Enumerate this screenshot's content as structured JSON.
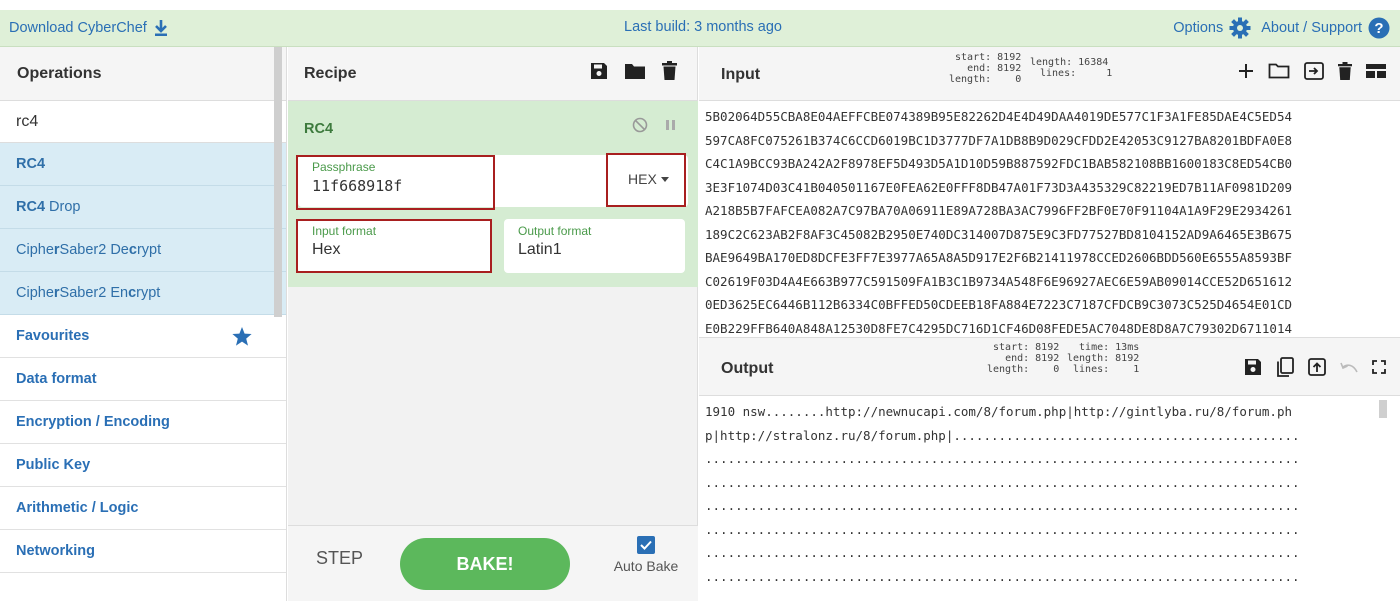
{
  "banner": {
    "download_label": "Download CyberChef",
    "build_label": "Last build: 3 months ago",
    "options_label": "Options",
    "about_label": "About / Support"
  },
  "operations": {
    "header": "Operations",
    "search_value": "rc4",
    "results": [
      {
        "strong": "RC4",
        "rest": ""
      },
      {
        "strong": "RC4",
        "rest": " Drop"
      },
      {
        "pre": "Ciphe",
        "strong": "r",
        "mid": "Saber2 De",
        "strong2": "c",
        "post": "rypt"
      },
      {
        "pre": "Ciphe",
        "strong": "r",
        "mid": "Saber2 En",
        "strong2": "c",
        "post": "rypt"
      }
    ],
    "categories": [
      "Favourites",
      "Data format",
      "Encryption / Encoding",
      "Public Key",
      "Arithmetic / Logic",
      "Networking"
    ]
  },
  "recipe": {
    "header": "Recipe",
    "operation_title": "RC4",
    "passphrase_label": "Passphrase",
    "passphrase_value": "11f668918f",
    "passphrase_format": "HEX",
    "input_format_label": "Input format",
    "input_format_value": "Hex",
    "output_format_label": "Output format",
    "output_format_value": "Latin1",
    "step_label": "STEP",
    "bake_label": "BAKE!",
    "autobake_label": "Auto Bake",
    "autobake_checked": true
  },
  "input": {
    "title": "Input",
    "stats_left": [
      "start: 8192",
      "end: 8192",
      "length:    0"
    ],
    "stats_right": [
      "length: 16384",
      "lines:     1"
    ],
    "lines": [
      "5B02064D55CBA8E04AEFFCBE074389B95E82262D4E4D49DAA4019DE577C1F3A1FE85DAE4C5ED54",
      "597CA8FC075261B374C6CCD6019BC1D3777DF7A1DB8B9D029CFDD2E42053C9127BA8201BDFA0E8",
      "C4C1A9BCC93BA242A2F8978EF5D493D5A1D10D59B887592FDC1BAB582108BB1600183C8ED54CB0",
      "3E3F1074D03C41B040501167E0FEA62E0FFF8DB47A01F73D3A435329C82219ED7B11AF0981D209",
      "A218B5B7FAFCEA082A7C97BA70A06911E89A728BA3AC7996FF2BF0E70F91104A1A9F29E2934261",
      "189C2C623AB2F8AF3C45082B2950E740DC314007D875E9C3FD77527BD8104152AD9A6465E3B675",
      "BAE9649BA170ED8DCFE3FF7E3977A65A8A5D917E2F6B21411978CCED2606BDD560E6555A8593BF",
      "C02619F03D4A4E663B977C591509FA1B3C1B9734A548F6E96927AEC6E59AB09014CCE52D651612",
      "0ED3625EC6446B112B6334C0BFFED50CDEEB18FA884E7223C7187CFDCB9C3073C525D4654E01CD",
      "E0B229FFB640A848A12530D8FE7C4295DC716D1CF46D08FEDE5AC7048DE8D8A7C79302D6711014"
    ]
  },
  "output": {
    "title": "Output",
    "stats_left": [
      "start: 8192",
      "end: 8192",
      "length:    0"
    ],
    "stats_right": [
      "time: 13ms",
      "length: 8192",
      "lines:    1"
    ],
    "lines": [
      "1910 nsw........http://newnucapi.com/8/forum.php|http://gintlyba.ru/8/forum.ph",
      "p|http://stralonz.ru/8/forum.php|..............................................",
      "...............................................................................",
      "...............................................................................",
      "...............................................................................",
      "...............................................................................",
      "...............................................................................",
      "...............................................................................",
      "..............................................................................."
    ]
  },
  "colors": {
    "banner_bg": "#dff0d8",
    "link_blue": "#2a6fb5",
    "op_green": "#d5ecd2",
    "highlight_red": "#a81f1f",
    "bake_green": "#5cb85c"
  }
}
